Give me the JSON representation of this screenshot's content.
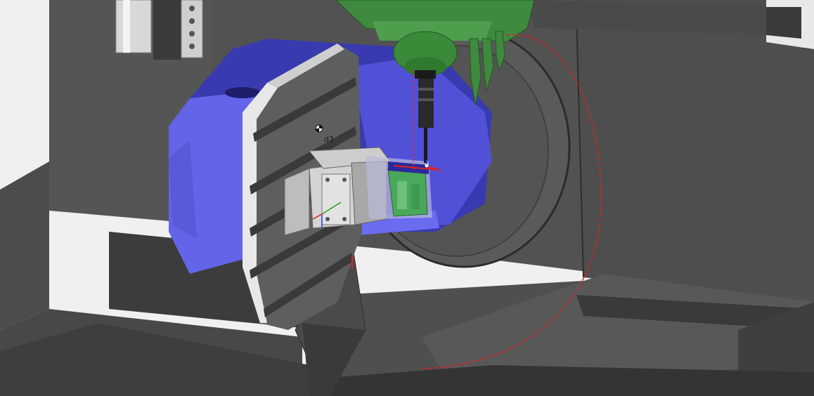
{
  "viewport": {
    "annotation_label": "d3"
  },
  "colors": {
    "background_wall": "#f2f2f2",
    "machine_body": "#4a4a4a",
    "machine_dark": "#3a3a3a",
    "rotary_table": "#6a6aee",
    "rotary_table_dark": "#3d3db8",
    "platter_face": "#5c5c5c",
    "spindle_head": "#3f8a3f",
    "workpiece": "#4aa85a",
    "fixture": "#c8c8c8",
    "toolpath": "#e02020",
    "axis_x": "#e02020",
    "axis_y": "#20a020",
    "axis_z": "#2040e0"
  },
  "icons": {
    "origin_marker": "origin-target-icon",
    "coordinate_triad": "coordinate-axes-icon"
  }
}
